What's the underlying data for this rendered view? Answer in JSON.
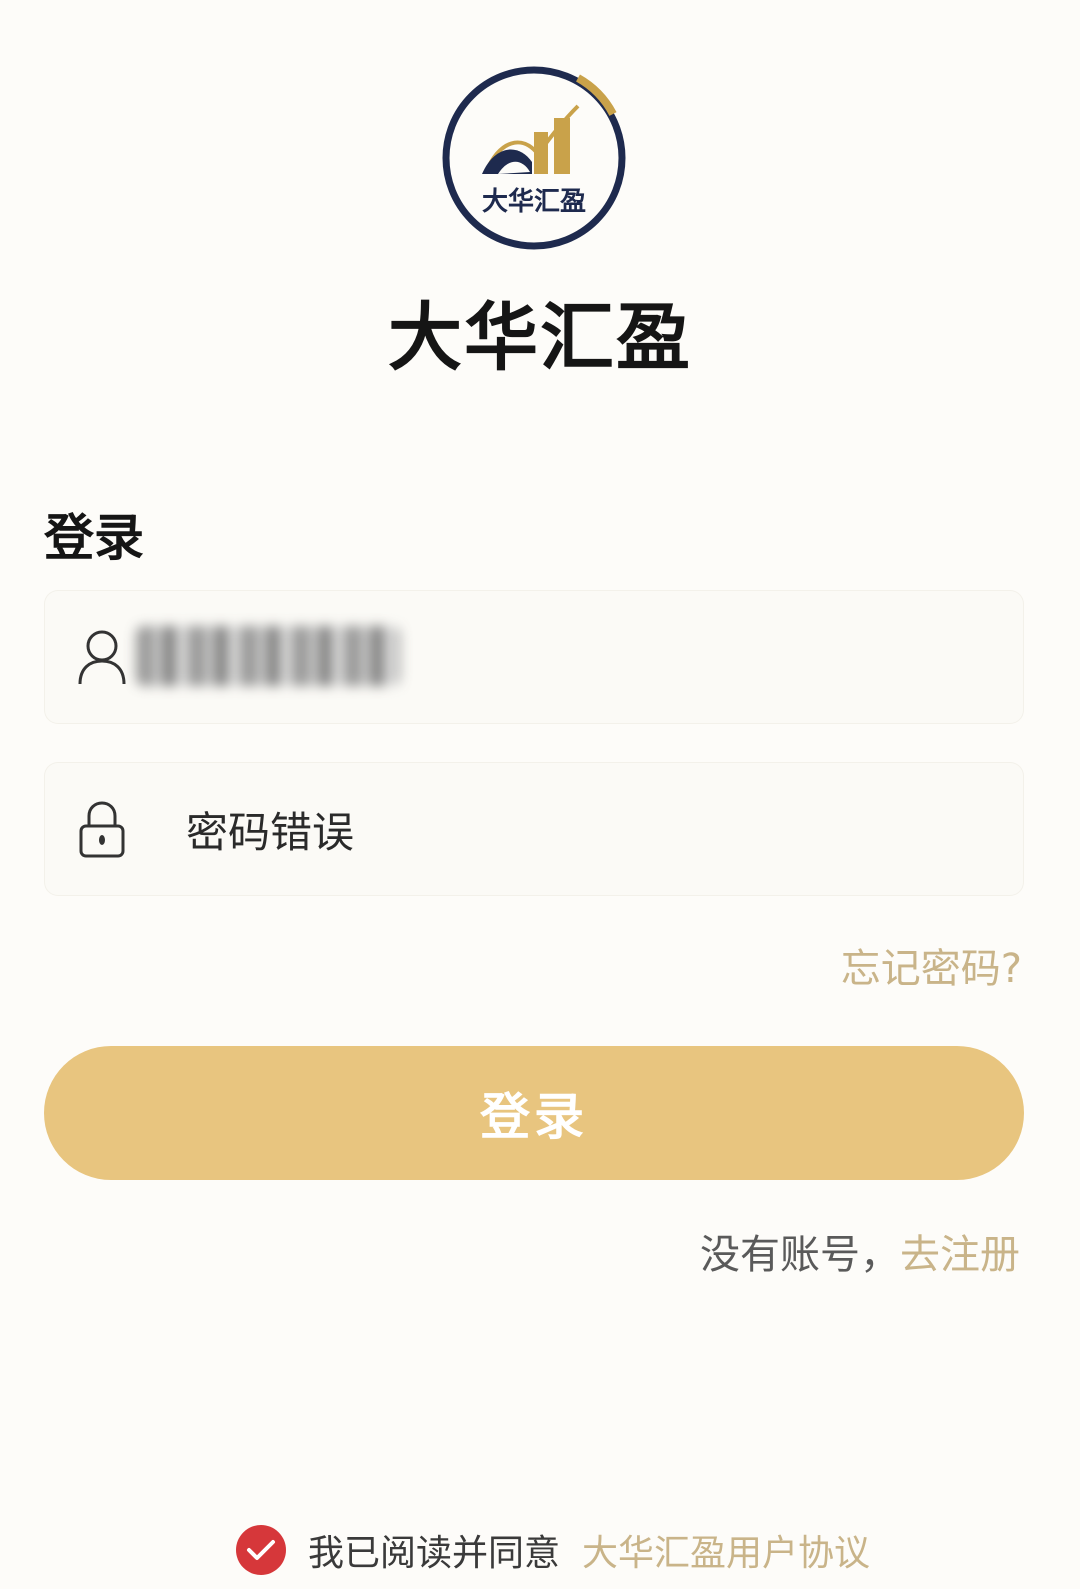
{
  "app": {
    "logo_text": "大华汇盈",
    "name": "大华汇盈"
  },
  "login": {
    "title": "登录",
    "username_value": "",
    "password_value": "密码错误",
    "forgot_label": "忘记密码?",
    "submit_label": "登录",
    "no_account_text": "没有账号，",
    "register_link": "去注册"
  },
  "agreement": {
    "prefix": "我已阅读并同意",
    "link": "大华汇盈用户协议",
    "checked": true
  },
  "icons": {
    "username": "user-icon",
    "password": "lock-icon",
    "check": "check-icon"
  },
  "colors": {
    "accent": "#c9b489",
    "button": "#e8c57f",
    "logo_navy": "#1e2a4e",
    "logo_gold": "#c9a24a",
    "check_red": "#d6373a"
  }
}
